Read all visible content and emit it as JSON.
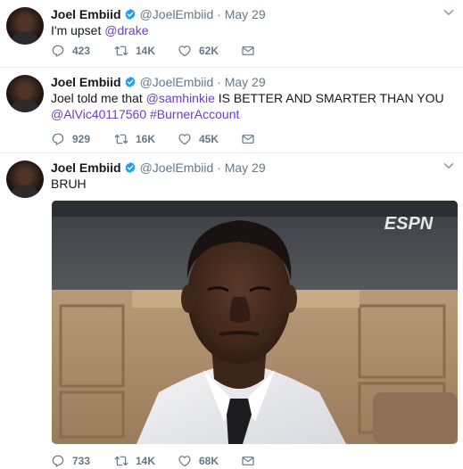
{
  "tweets": [
    {
      "name": "Joel Embiid",
      "handle": "@JoelEmbiid",
      "separator": "·",
      "date": "May 29",
      "text_parts": [
        {
          "text": "I'm upset ",
          "link": false
        },
        {
          "text": "@drake",
          "link": true
        }
      ],
      "replies": "423",
      "retweets": "14K",
      "likes": "62K"
    },
    {
      "name": "Joel Embiid",
      "handle": "@JoelEmbiid",
      "separator": "·",
      "date": "May 29",
      "text_parts": [
        {
          "text": "Joel told me that ",
          "link": false
        },
        {
          "text": "@samhinkie",
          "link": true
        },
        {
          "text": " IS BETTER AND SMARTER THAN YOU ",
          "link": false
        },
        {
          "text": "@AlVic40117560",
          "link": true
        },
        {
          "text": " ",
          "link": false
        },
        {
          "text": "#BurnerAccount",
          "link": true
        }
      ],
      "replies": "929",
      "retweets": "16K",
      "likes": "45K"
    },
    {
      "name": "Joel Embiid",
      "handle": "@JoelEmbiid",
      "separator": "·",
      "date": "May 29",
      "text_parts": [
        {
          "text": "BRUH",
          "link": false
        }
      ],
      "media": {
        "watermark": "ESPN"
      },
      "replies": "733",
      "retweets": "14K",
      "likes": "68K"
    }
  ],
  "colors": {
    "link": "#6b3fbf",
    "verified": "#1da1f2",
    "muted": "#657786",
    "text": "#14171a",
    "divider": "#e6ecf0"
  },
  "icons": {
    "verified": "verified-badge-icon",
    "chevron": "chevron-down-icon",
    "reply": "reply-icon",
    "retweet": "retweet-icon",
    "like": "heart-icon",
    "dm": "envelope-icon"
  }
}
